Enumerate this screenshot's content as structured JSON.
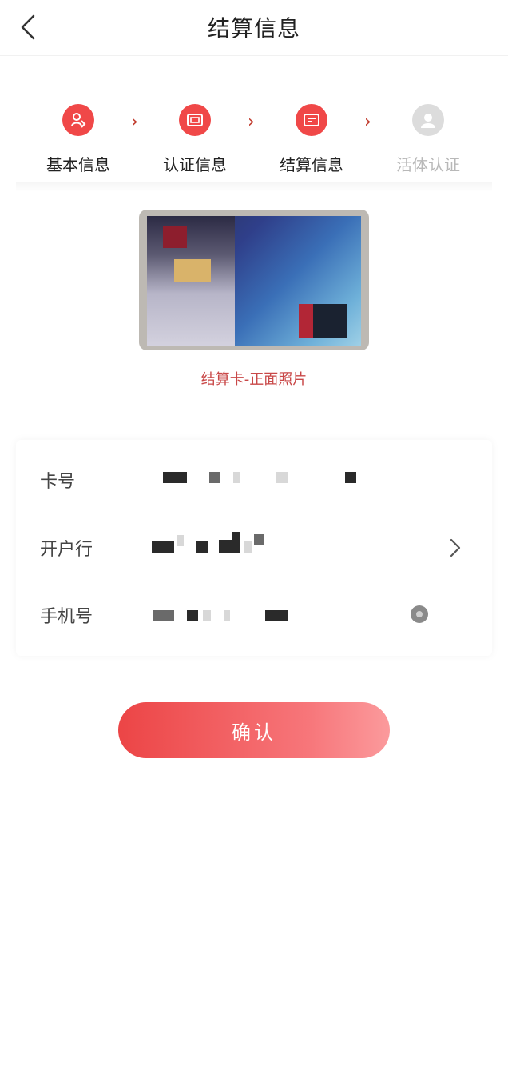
{
  "header": {
    "title": "结算信息"
  },
  "steps": [
    {
      "label": "基本信息",
      "icon": "person-icon",
      "active": true
    },
    {
      "label": "认证信息",
      "icon": "id-card-icon",
      "active": true
    },
    {
      "label": "结算信息",
      "icon": "bank-card-icon",
      "active": true
    },
    {
      "label": "活体认证",
      "icon": "face-icon",
      "active": false
    }
  ],
  "step_separator": "›",
  "card": {
    "caption": "结算卡-正面照片"
  },
  "form": {
    "card_number_label": "卡号",
    "bank_label": "开户行",
    "phone_label": "手机号"
  },
  "confirm_label": "确认",
  "colors": {
    "accent": "#ec4546",
    "inactive": "#dcdcdc"
  }
}
